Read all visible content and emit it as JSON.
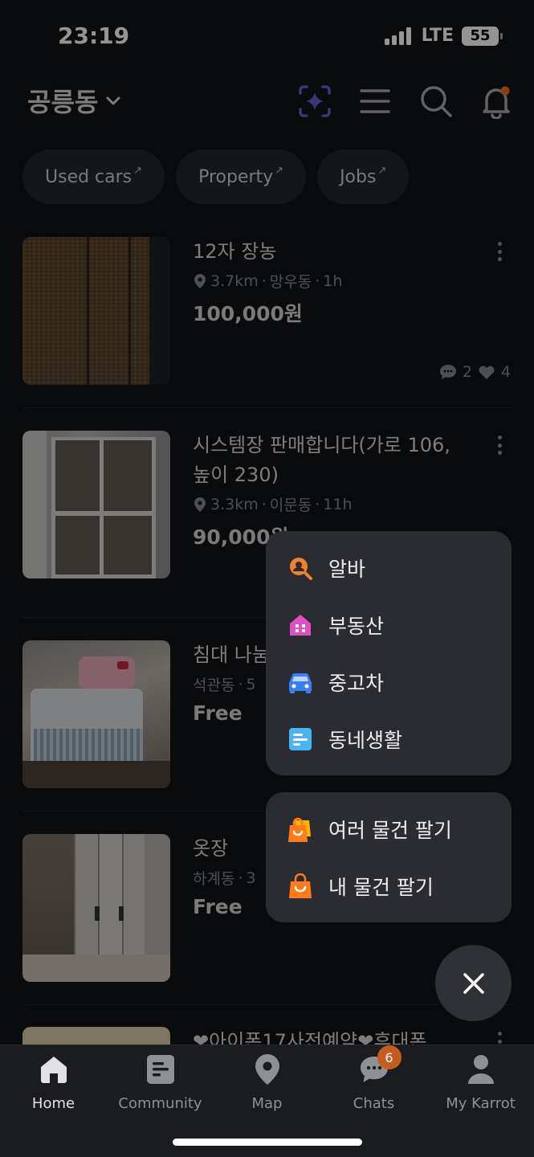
{
  "status_bar": {
    "time": "23:19",
    "network": "LTE",
    "battery": "55"
  },
  "header": {
    "location": "공릉동",
    "icons": [
      "sparkle-scan-icon",
      "menu-icon",
      "search-icon",
      "bell-icon"
    ]
  },
  "chips": [
    {
      "label": "Used cars"
    },
    {
      "label": "Property"
    },
    {
      "label": "Jobs"
    }
  ],
  "listings": [
    {
      "title": "12자 장농",
      "distance": "3.7km",
      "area": "망우동",
      "time": "1h",
      "price": "100,000원",
      "chats": "2",
      "likes": "4"
    },
    {
      "title": "시스템장 판매합니다(가로 106, 높이 230)",
      "distance": "3.3km",
      "area": "이문동",
      "time": "11h",
      "price": "90,000원"
    },
    {
      "title": "침대 나눔",
      "area": "석관동",
      "time": "5",
      "price": "Free"
    },
    {
      "title": "옷장",
      "area": "하계동",
      "time": "3",
      "price": "Free"
    },
    {
      "title": "❤아이폰17사전예약❤휴대폰"
    }
  ],
  "menu_top": [
    {
      "label": "알바",
      "icon": "jobs-search-icon",
      "color": "#f0822a"
    },
    {
      "label": "부동산",
      "icon": "house-icon",
      "color": "#e04fc2"
    },
    {
      "label": "중고차",
      "icon": "car-icon",
      "color": "#3a7ff0"
    },
    {
      "label": "동네생활",
      "icon": "post-icon",
      "color": "#4ab4f2"
    }
  ],
  "menu_bottom": [
    {
      "label": "여러 물건 팔기",
      "icon": "multi-bag-icon",
      "color": "#ff7b1a"
    },
    {
      "label": "내 물건 팔기",
      "icon": "bag-icon",
      "color": "#ff7b1a"
    }
  ],
  "bottom_nav": [
    {
      "label": "Home",
      "icon": "home-icon",
      "active": true
    },
    {
      "label": "Community",
      "icon": "community-icon"
    },
    {
      "label": "Map",
      "icon": "map-pin-icon"
    },
    {
      "label": "Chats",
      "icon": "chat-icon",
      "badge": "6"
    },
    {
      "label": "My Karrot",
      "icon": "person-icon"
    }
  ]
}
